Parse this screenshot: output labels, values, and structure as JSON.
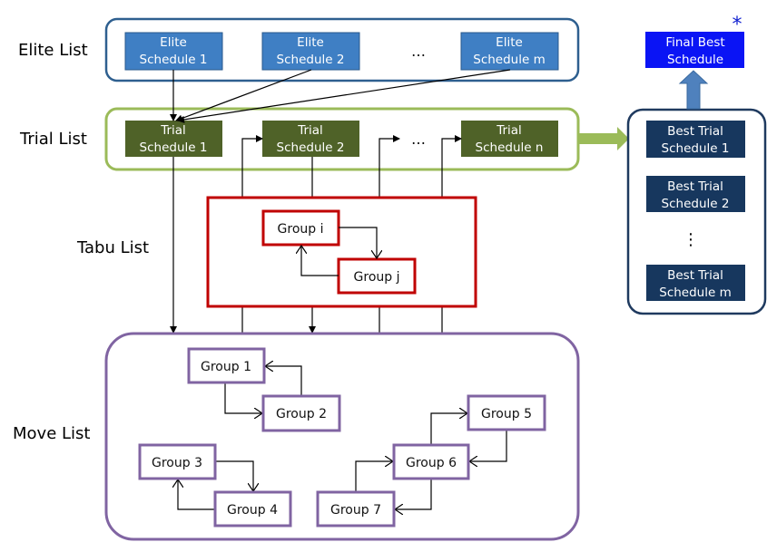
{
  "labels": {
    "elite": "Elite List",
    "trial": "Trial List",
    "tabu": "Tabu List",
    "move": "Move List"
  },
  "elite": [
    {
      "l1": "Elite",
      "l2": "Schedule 1"
    },
    {
      "l1": "Elite",
      "l2": "Schedule 2"
    },
    {
      "l1": "Elite",
      "l2": "Schedule m"
    }
  ],
  "trial": [
    {
      "l1": "Trial",
      "l2": "Schedule 1"
    },
    {
      "l1": "Trial",
      "l2": "Schedule 2"
    },
    {
      "l1": "Trial",
      "l2": "Schedule n"
    }
  ],
  "ellipsis": "…",
  "vdots": "⋮",
  "best": [
    {
      "l1": "Best Trial",
      "l2": "Schedule 1"
    },
    {
      "l1": "Best Trial",
      "l2": "Schedule 2"
    },
    {
      "l1": "Best Trial",
      "l2": "Schedule m"
    }
  ],
  "final": {
    "l1": "Final Best",
    "l2": "Schedule",
    "mark": "*"
  },
  "tabu": {
    "group_i": "Group i",
    "group_j": "Group j"
  },
  "move": [
    "Group 1",
    "Group 2",
    "Group 3",
    "Group 4",
    "Group 5",
    "Group 6",
    "Group 7"
  ],
  "colors": {
    "elite_fill": "#3f7fc4",
    "trial_fill": "#4f6228",
    "best_fill": "#17375e",
    "final_fill": "#0a14f5",
    "elite_border": "#2e5f8f",
    "trial_border": "#9bbb59",
    "tabu_border": "#c00000",
    "move_border": "#8064a2"
  }
}
